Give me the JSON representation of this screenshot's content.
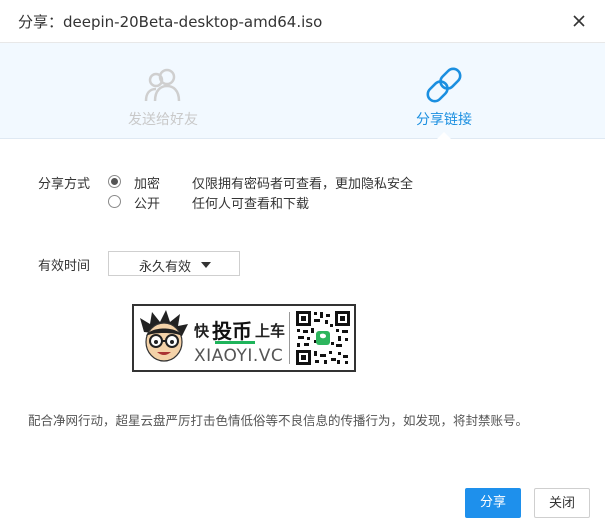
{
  "window": {
    "title": "分享：deepin-20Beta-desktop-amd64.iso",
    "close_icon": "close-icon"
  },
  "tabs": [
    {
      "label": "发送给好友",
      "icon": "users-icon",
      "active": false
    },
    {
      "label": "分享链接",
      "icon": "link-icon",
      "active": true
    }
  ],
  "share_method": {
    "label": "分享方式",
    "options": [
      {
        "label": "加密",
        "description": "仅限拥有密码者可查看，更加隐私安全",
        "selected": true
      },
      {
        "label": "公开",
        "description": "任何人可查看和下载",
        "selected": false
      }
    ]
  },
  "validity": {
    "label": "有效时间",
    "selected": "永久有效"
  },
  "banner": {
    "text_1": "快",
    "text_2": "投币",
    "text_3": "上车",
    "subtext": "XIAOYI.VC"
  },
  "notice": "配合净网行动，超星云盘严厉打击色情低俗等不良信息的传播行为，如发现，将封禁账号。",
  "buttons": {
    "share": "分享",
    "close": "关闭"
  },
  "colors": {
    "accent": "#1e90ec",
    "tab_active": "#1b8fe0",
    "tab_inactive": "#c9c9c9"
  }
}
